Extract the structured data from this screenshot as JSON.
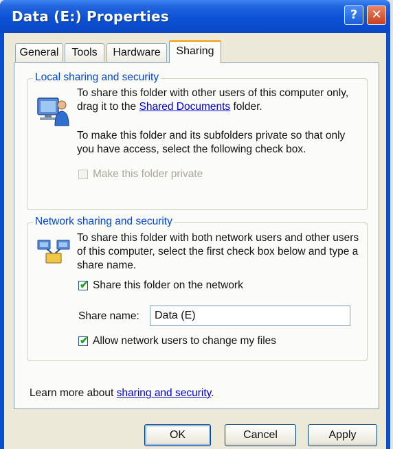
{
  "window": {
    "title": "Data (E:) Properties"
  },
  "titlebar": {
    "help_glyph": "?",
    "close_glyph": "✕"
  },
  "tabs": [
    {
      "label": "General"
    },
    {
      "label": "Tools"
    },
    {
      "label": "Hardware"
    },
    {
      "label": "Sharing",
      "active": true
    }
  ],
  "local": {
    "legend": "Local sharing and security",
    "text1_pre": "To share this folder with other users of this computer only, drag it to the ",
    "text1_link": "Shared Documents",
    "text1_post": " folder.",
    "text2": "To make this folder and its subfolders private so that only you have access, select the following check box.",
    "private_label": "Make this folder private",
    "private_checked": false,
    "private_enabled": false
  },
  "network": {
    "legend": "Network sharing and security",
    "text": "To share this folder with both network users and other users of this computer, select the first check box below and type a share name.",
    "share_label": "Share this folder on the network",
    "share_checked": true,
    "share_name_label": "Share name:",
    "share_name_value": "Data (E)",
    "allow_label": "Allow network users to change my files",
    "allow_checked": true
  },
  "learn": {
    "pre": "Learn more about ",
    "link": "sharing and security",
    "post": "."
  },
  "buttons": {
    "ok": "OK",
    "cancel": "Cancel",
    "apply": "Apply"
  },
  "check_glyph": "✔",
  "colors": {
    "accent": "#0046d5",
    "titlebar": "#0a4dc8",
    "tab_highlight": "#f2b03c"
  }
}
